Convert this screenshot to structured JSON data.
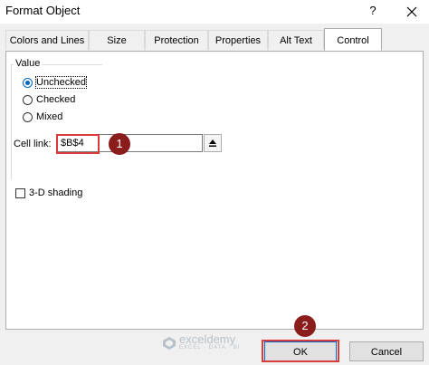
{
  "window": {
    "title": "Format Object",
    "help_label": "?"
  },
  "tabs": [
    {
      "label": "Colors and Lines",
      "active": false
    },
    {
      "label": "Size",
      "active": false
    },
    {
      "label": "Protection",
      "active": false
    },
    {
      "label": "Properties",
      "active": false
    },
    {
      "label": "Alt Text",
      "active": false
    },
    {
      "label": "Control",
      "active": true
    }
  ],
  "value_group": {
    "label": "Value",
    "options": [
      {
        "label": "Unchecked",
        "checked": true
      },
      {
        "label": "Checked",
        "checked": false
      },
      {
        "label": "Mixed",
        "checked": false
      }
    ]
  },
  "cell_link": {
    "label": "Cell link:",
    "value": "$B$4",
    "collapse_icon": "arrow-up-collapse-icon"
  },
  "shading": {
    "label": "3-D shading",
    "checked": false
  },
  "callouts": [
    {
      "number": "1"
    },
    {
      "number": "2"
    }
  ],
  "watermark": {
    "name": "exceldemy",
    "tagline": "EXCEL · DATA · BI"
  },
  "buttons": {
    "ok_label": "OK",
    "cancel_label": "Cancel"
  },
  "colors": {
    "accent": "#0067c0",
    "highlight": "#d93a3a",
    "badge": "#8b1c1c"
  }
}
